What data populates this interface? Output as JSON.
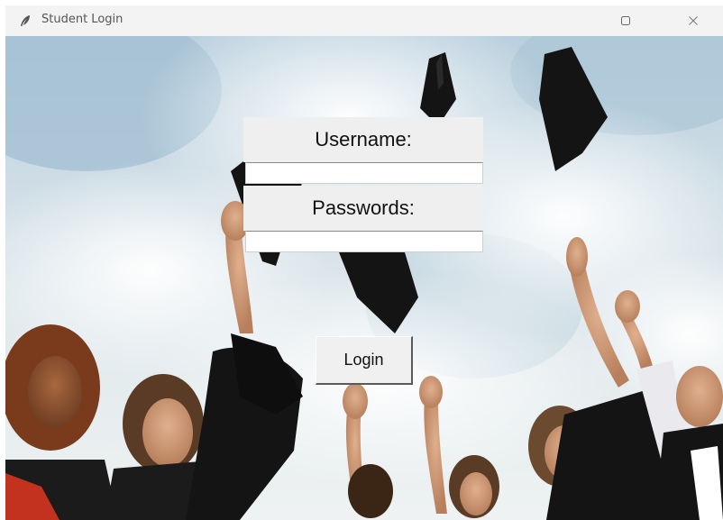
{
  "window": {
    "title": "Student Login",
    "maximize_icon": "maximize-icon",
    "close_icon": "close-icon",
    "app_icon": "feather-icon"
  },
  "form": {
    "username_label": "Username:",
    "username_value": "",
    "password_label": "Passwords:",
    "password_value": "",
    "login_label": "Login"
  },
  "background": {
    "description_icon": "graduation-photo",
    "sky_color": "#d9e4ea",
    "cap_color": "#141414"
  }
}
